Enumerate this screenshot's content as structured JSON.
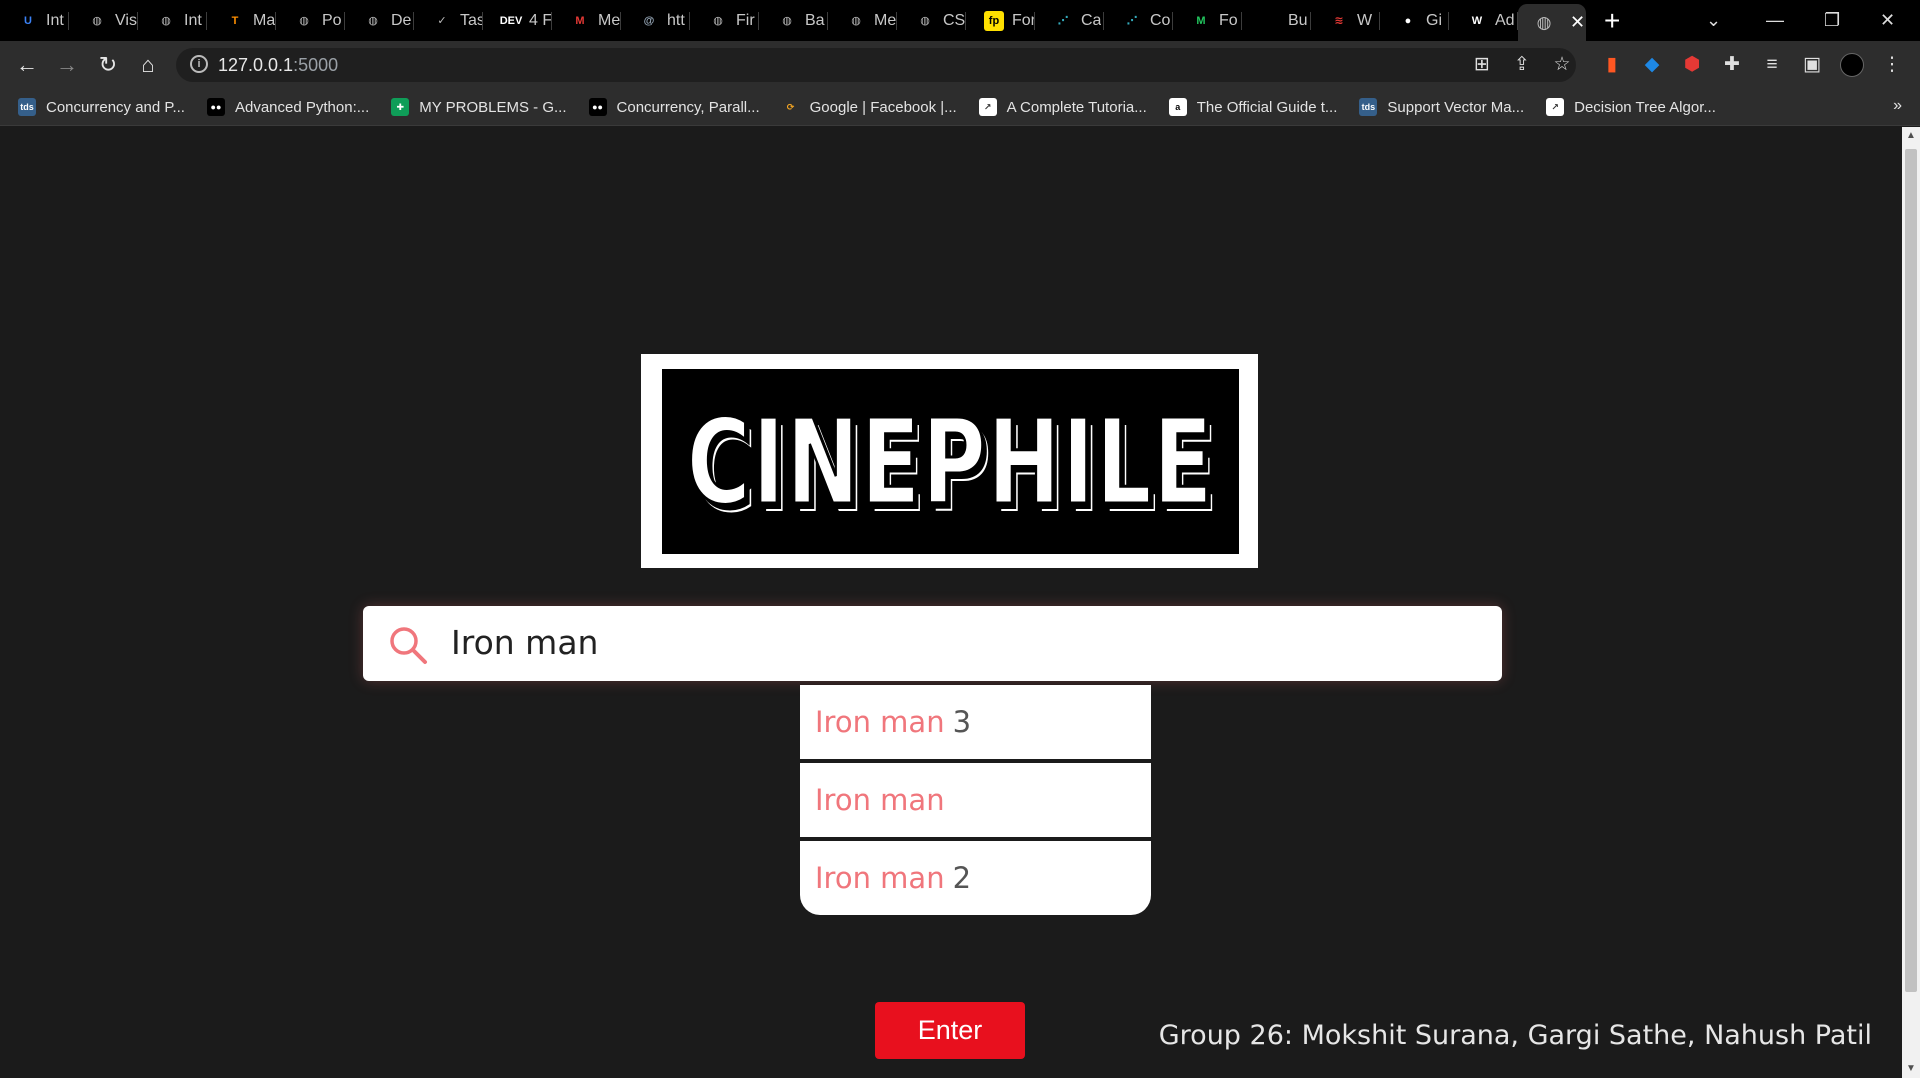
{
  "tabs": [
    {
      "title": "Int",
      "favicon": "u-logo-icon",
      "color": "#3b82f6"
    },
    {
      "title": "Vis",
      "favicon": "globe-icon",
      "color": "#bbbbbb"
    },
    {
      "title": "Int",
      "favicon": "globe-icon",
      "color": "#bbbbbb"
    },
    {
      "title": "Ma",
      "favicon": "tensorflow-icon",
      "color": "#ff8f00"
    },
    {
      "title": "Po",
      "favicon": "globe-icon",
      "color": "#bbbbbb"
    },
    {
      "title": "De",
      "favicon": "globe-icon",
      "color": "#bbbbbb"
    },
    {
      "title": "Tas",
      "favicon": "check-icon",
      "color": "#bbbbbb"
    },
    {
      "title": "4 F",
      "favicon": "dev-icon",
      "color": "#ffffff"
    },
    {
      "title": "Me",
      "favicon": "om-icon",
      "color": "#e53935"
    },
    {
      "title": "htt",
      "favicon": "at-icon",
      "color": "#9ab"
    },
    {
      "title": "Fir",
      "favicon": "globe-icon",
      "color": "#bbbbbb"
    },
    {
      "title": "Ba",
      "favicon": "globe-icon",
      "color": "#bbbbbb"
    },
    {
      "title": "Me",
      "favicon": "globe-icon",
      "color": "#bbbbbb"
    },
    {
      "title": "CS",
      "favicon": "globe-icon",
      "color": "#bbbbbb"
    },
    {
      "title": "For",
      "favicon": "fp-icon",
      "color": "#ffe000"
    },
    {
      "title": "Ca",
      "favicon": "graph-icon",
      "color": "#3ab"
    },
    {
      "title": "Co",
      "favicon": "graph-icon",
      "color": "#3ab"
    },
    {
      "title": "Fo",
      "favicon": "m-logo-icon",
      "color": "#22c55e"
    },
    {
      "title": "Bu",
      "favicon": "blank-icon",
      "color": "#000000"
    },
    {
      "title": "W",
      "favicon": "stack-icon",
      "color": "#e53935"
    },
    {
      "title": "Gi",
      "favicon": "github-icon",
      "color": "#ffffff"
    },
    {
      "title": "Ad",
      "favicon": "wikipedia-icon",
      "color": "#ffffff"
    }
  ],
  "active_tab": {
    "title": "",
    "favicon": "globe-icon"
  },
  "url": {
    "host": "127.0.0.1",
    "port": ":5000"
  },
  "bookmarks": [
    {
      "label": "Concurrency and P...",
      "favicon": "tds-icon"
    },
    {
      "label": "Advanced Python:...",
      "favicon": "medium-icon"
    },
    {
      "label": "MY PROBLEMS - G...",
      "favicon": "sheets-icon"
    },
    {
      "label": "Concurrency, Parall...",
      "favicon": "medium-icon"
    },
    {
      "label": "Google | Facebook |...",
      "favicon": "leetcode-icon"
    },
    {
      "label": "A Complete Tutoria...",
      "favicon": "chart-icon"
    },
    {
      "label": "The Official Guide t...",
      "favicon": "amazon-icon"
    },
    {
      "label": "Support Vector Ma...",
      "favicon": "tds-icon"
    },
    {
      "label": "Decision Tree Algor...",
      "favicon": "chart-icon"
    }
  ],
  "logo": {
    "text": "CINEPHILE"
  },
  "search": {
    "query": "Iron man"
  },
  "suggestions": [
    {
      "match": "Iron man",
      "rest": "3"
    },
    {
      "match": "Iron man",
      "rest": ""
    },
    {
      "match": "Iron man",
      "rest": "2"
    }
  ],
  "enter_button": {
    "label": "Enter"
  },
  "credits": "Group 26: Mokshit Surana, Gargi Sathe, Nahush Patil",
  "colors": {
    "accent": "#e8101e",
    "highlight": "#f0767c",
    "page_bg": "#1b1b1b"
  }
}
